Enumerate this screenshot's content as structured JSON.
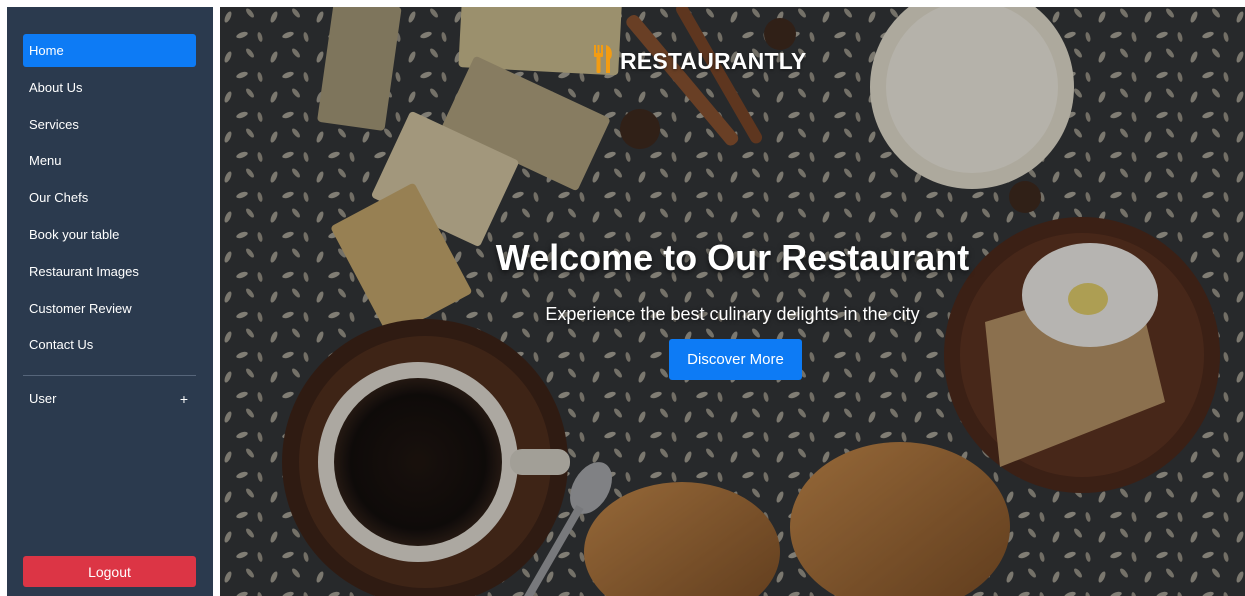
{
  "sidebar": {
    "items": [
      {
        "label": "Home",
        "active": true
      },
      {
        "label": "About Us"
      },
      {
        "label": "Services"
      },
      {
        "label": "Menu"
      },
      {
        "label": "Our Chefs"
      },
      {
        "label": "Book your table"
      },
      {
        "label": "Restaurant Images"
      },
      {
        "label": "Customer Review"
      },
      {
        "label": "Contact Us"
      }
    ],
    "user": {
      "label": "User",
      "expand_symbol": "+"
    },
    "logout_label": "Logout"
  },
  "hero": {
    "brand": {
      "name": "RESTAURANTLY",
      "icon": "utensils-icon"
    },
    "title": "Welcome to Our Restaurant",
    "subtitle": "Experience the best culinary delights in the city",
    "cta_label": "Discover More"
  },
  "colors": {
    "sidebar_bg": "#2b3a4e",
    "active_item": "#0d7bf5",
    "primary_button": "#0d7bf5",
    "logout_button": "#dc3545",
    "brand_icon": "#f39c12"
  }
}
